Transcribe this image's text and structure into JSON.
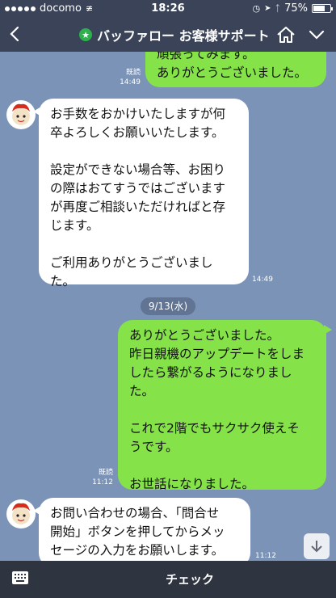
{
  "status": {
    "carrier": "docomo",
    "time": "18:26",
    "battery": "75%",
    "battery_level": 0.75
  },
  "header": {
    "title": "バッファロー お客様サポート",
    "official_badge_icon": "star-badge-icon",
    "back_icon": "back-chevron-icon",
    "home_icon": "home-icon",
    "menu_icon": "chevron-down-icon"
  },
  "messages": [
    {
      "side": "out",
      "text": "頑張ってみます。\nありがとうございました。",
      "read": "既読",
      "time": "14:49"
    },
    {
      "side": "in",
      "text": "お手数をおかけいたしますが何\n卒よろしくお願いいたします。\n\n設定ができない場合等、お困り\nの際はおてすうではございます\nが再度ご相談いただければと存\nじます。\n\nご利用ありがとうございまし\nた。",
      "time": "14:49"
    },
    {
      "side": "out",
      "text": "ありがとうございました。\n昨日親機のアップデートをしま\nしたら繋がるようになりまし\nた。\n\nこれで2階でもサクサク使えそ\nうです。\n\nお世話になりました。",
      "read": "既読",
      "time": "11:12"
    },
    {
      "side": "in",
      "text": "お問い合わせの場合、「問合せ\n開始」ボタンを押してからメッ\nセージの入力をお願いします。",
      "time": "11:12"
    }
  ],
  "date_divider": "9/13(水)",
  "bottom": {
    "keyboard_icon": "keyboard-icon",
    "check_label": "チェック"
  },
  "colors": {
    "chat_bg": "#7b93b7",
    "header_bg": "#3a4357",
    "out_bubble": "#85e249",
    "in_bubble": "#ffffff"
  }
}
